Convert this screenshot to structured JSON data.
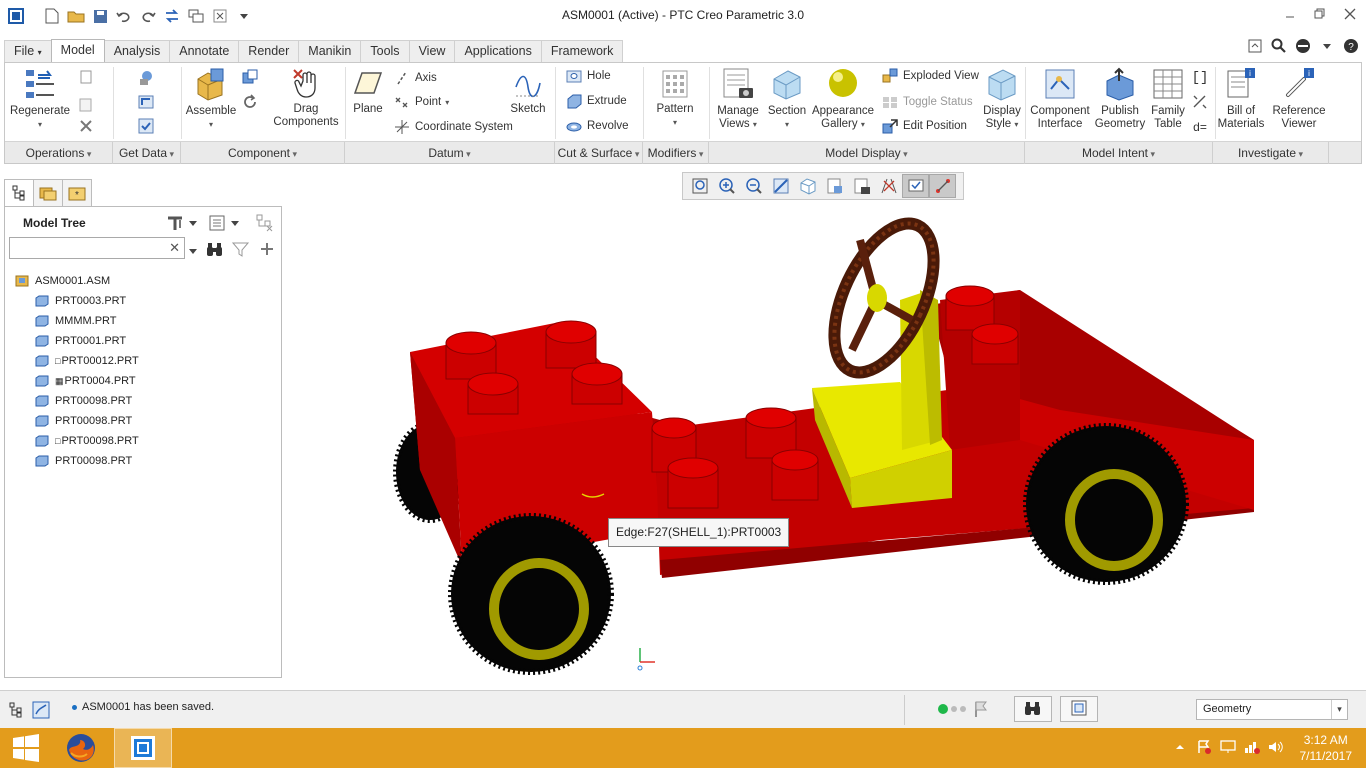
{
  "window": {
    "title": "ASM0001 (Active) - PTC Creo Parametric 3.0"
  },
  "tabs": [
    "File",
    "Model",
    "Analysis",
    "Annotate",
    "Render",
    "Manikin",
    "Tools",
    "View",
    "Applications",
    "Framework"
  ],
  "active_tab": "Model",
  "ribbon": {
    "regenerate": "Regenerate",
    "assemble": "Assemble",
    "drag_components": [
      "Drag",
      "Components"
    ],
    "plane": "Plane",
    "axis": "Axis",
    "point": "Point",
    "coordinate_system": "Coordinate System",
    "sketch": "Sketch",
    "hole": "Hole",
    "extrude": "Extrude",
    "revolve": "Revolve",
    "pattern": "Pattern",
    "manage_views": [
      "Manage",
      "Views"
    ],
    "section": "Section",
    "appearance_gallery": [
      "Appearance",
      "Gallery"
    ],
    "exploded_view": "Exploded View",
    "toggle_status": "Toggle Status",
    "edit_position": "Edit Position",
    "display_style": [
      "Display",
      "Style"
    ],
    "component_interface": [
      "Component",
      "Interface"
    ],
    "publish_geometry": [
      "Publish",
      "Geometry"
    ],
    "family_table": [
      "Family",
      "Table"
    ],
    "bill_of_materials": [
      "Bill of",
      "Materials"
    ],
    "reference_viewer": [
      "Reference",
      "Viewer"
    ],
    "groups": [
      "Operations",
      "Get Data",
      "Component",
      "Datum",
      "Cut & Surface",
      "Modifiers",
      "Model Display",
      "Model Intent",
      "Investigate"
    ]
  },
  "model_tree": {
    "title": "Model Tree",
    "search_value": "",
    "root": "ASM0001.ASM",
    "items": [
      "PRT0003.PRT",
      "MMMM.PRT",
      "PRT0001.PRT",
      "PRT00012.PRT",
      "PRT0004.PRT",
      "PRT00098.PRT",
      "PRT00098.PRT",
      "PRT00098.PRT",
      "PRT00098.PRT"
    ]
  },
  "viewport": {
    "tooltip": "Edge:F27(SHELL_1):PRT0003"
  },
  "status": {
    "message": "ASM0001 has been saved.",
    "filter": "Geometry"
  },
  "taskbar": {
    "time": "3:12 AM",
    "date": "7/11/2017"
  },
  "colors": {
    "car_body": "#c00000",
    "seat": "#d4d400",
    "tire": "#050505",
    "rim": "#a09a00",
    "taskbar": "#e39c1c"
  }
}
